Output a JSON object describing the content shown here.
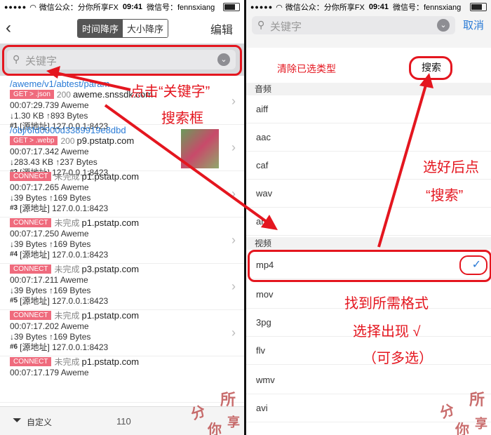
{
  "left": {
    "status": {
      "carrier": "微信公众：分你所享FX",
      "time": "09:41",
      "right": "微信号：fennsxiang"
    },
    "nav": {
      "back": "‹",
      "seg_on": "时间降序",
      "seg_off": "大小降序",
      "edit": "编辑"
    },
    "search": {
      "placeholder": "关键字"
    },
    "rows": [
      {
        "url": "/aweme/v1/abtest/param",
        "badge": "GET > .json",
        "code": "200",
        "host": "aweme.snssdk.com",
        "time": "00:07:29.739 Aweme",
        "size": "↓1.30 KB ↑893 Bytes",
        "num": "#1",
        "src": "[源地址] 127.0.0.1:8423"
      },
      {
        "url": "/obj/6fd0000d3389919e8dbd",
        "badge": "GET > .webp",
        "code": "200",
        "host": "p9.pstatp.com",
        "time": "00:07:17.342 Aweme",
        "size": "↓283.43 KB ↑237 Bytes",
        "num": "#2",
        "src": "[源地址] 127.0.0.1:8423"
      },
      {
        "badge": "CONNECT",
        "code": "未完成",
        "host": "p1.pstatp.com",
        "time": "00:07:17.265 Aweme",
        "size": "↓39 Bytes ↑169 Bytes",
        "num": "#3",
        "src": "[源地址] 127.0.0.1:8423"
      },
      {
        "badge": "CONNECT",
        "code": "未完成",
        "host": "p1.pstatp.com",
        "time": "00:07:17.250 Aweme",
        "size": "↓39 Bytes ↑169 Bytes",
        "num": "#4",
        "src": "[源地址] 127.0.0.1:8423"
      },
      {
        "badge": "CONNECT",
        "code": "未完成",
        "host": "p3.pstatp.com",
        "time": "00:07:17.211 Aweme",
        "size": "↓39 Bytes ↑169 Bytes",
        "num": "#5",
        "src": "[源地址] 127.0.0.1:8423"
      },
      {
        "badge": "CONNECT",
        "code": "未完成",
        "host": "p1.pstatp.com",
        "time": "00:07:17.202 Aweme",
        "size": "↓39 Bytes ↑169 Bytes",
        "num": "#6",
        "src": "[源地址] 127.0.0.1:8423"
      },
      {
        "badge": "CONNECT",
        "code": "未完成",
        "host": "p1.pstatp.com",
        "time": "00:07:17.179 Aweme"
      }
    ],
    "footer": {
      "custom": "自定义",
      "count": "110"
    },
    "annotation": {
      "line1": "点击“关键字”",
      "line2": "搜索框"
    }
  },
  "right": {
    "status": {
      "carrier": "微信公众：分你所享FX",
      "time": "09:41",
      "right": "微信号：fennsxiang"
    },
    "search": {
      "placeholder": "关键字",
      "cancel": "取消"
    },
    "actions": {
      "clear": "清除已选类型",
      "search": "搜索"
    },
    "sections": {
      "audio": "音频",
      "video": "视频"
    },
    "audio_items": [
      "aiff",
      "aac",
      "caf",
      "wav",
      "amr"
    ],
    "video_items": [
      "mp4",
      "mov",
      "3pg",
      "flv",
      "wmv",
      "avi"
    ],
    "selected": "mp4",
    "annotation": {
      "a1": "选好后点",
      "a2": "“搜索”",
      "b1": "找到所需格式",
      "b2": "选择出现 √",
      "b3": "（可多选）"
    }
  },
  "watermark": {
    "chars": [
      "分",
      "所",
      "你",
      "享"
    ]
  },
  "colors": {
    "annotation_red": "#e4161f",
    "link_blue": "#2a7bd6",
    "badge_pink": "#ef6b7d"
  }
}
